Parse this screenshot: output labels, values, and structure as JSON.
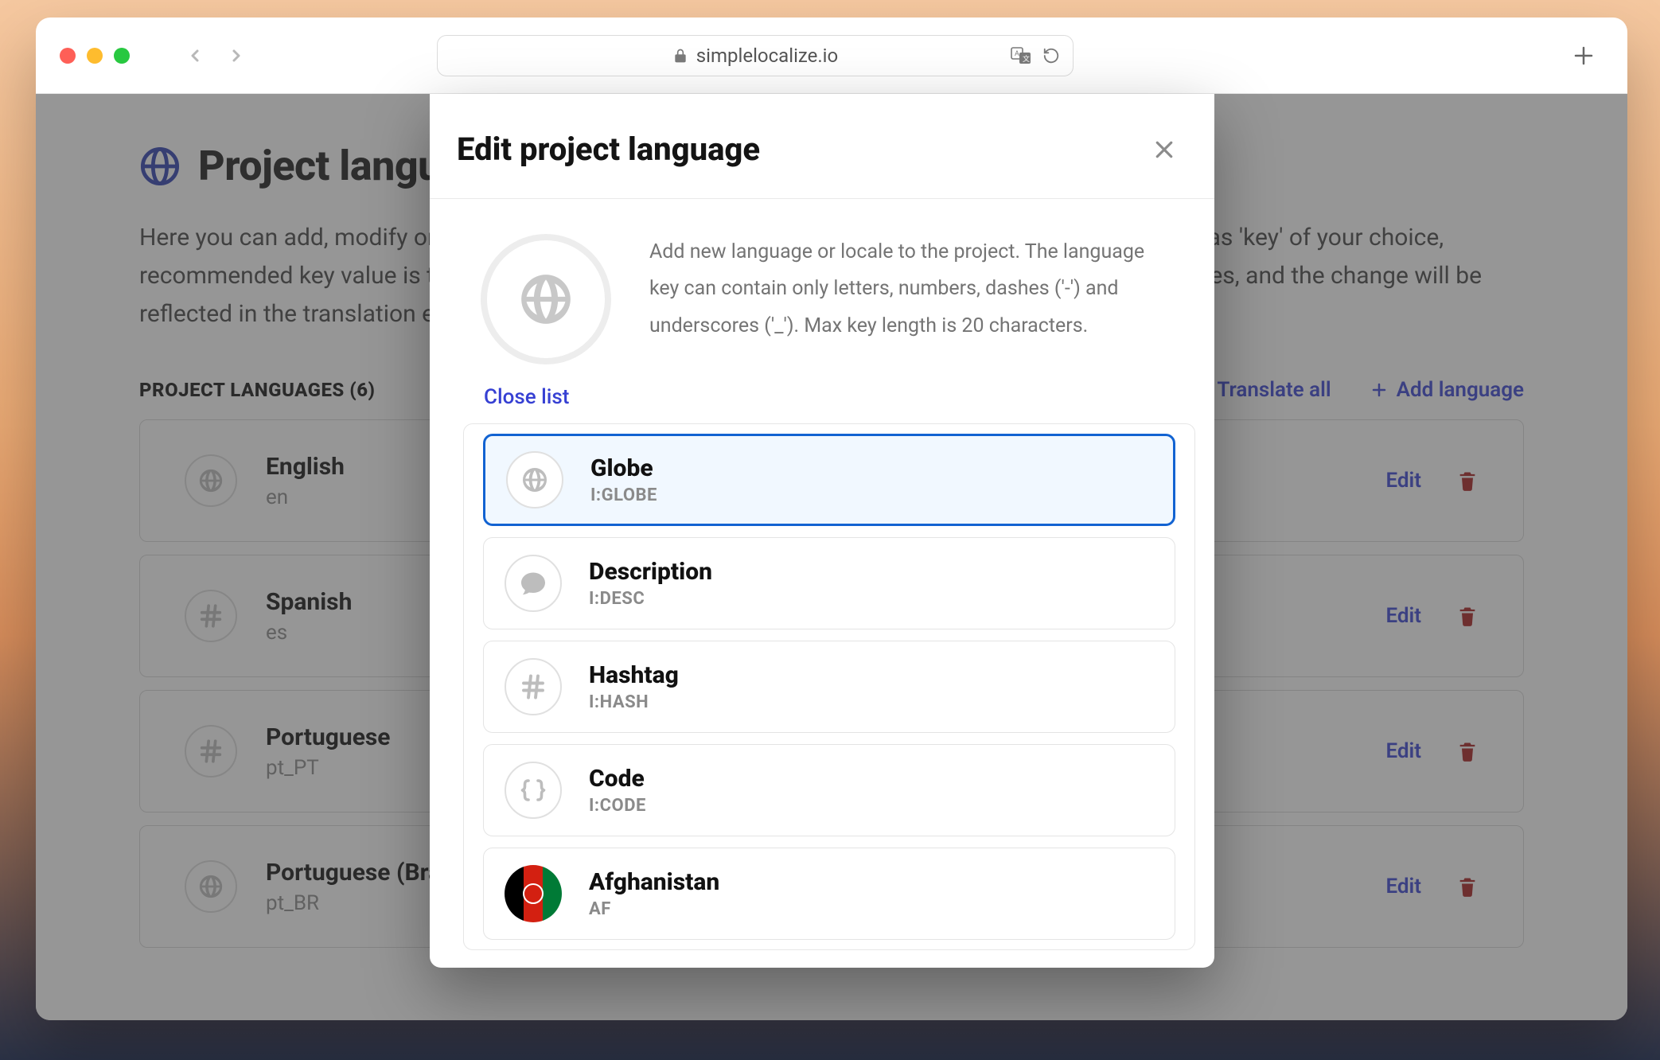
{
  "browser": {
    "url_host": "simplelocalize.io"
  },
  "page": {
    "title": "Project languages",
    "description": "Here you can add, modify or remove project languages along with their translations. Every language has 'key' of your choice, recommended key value is the locale or language code. You can also change the order of the languages, and the change will be reflected in the translation editor.",
    "list_heading": "PROJECT LANGUAGES (6)",
    "actions": {
      "translate_all": "Translate all",
      "add_language": "Add language"
    }
  },
  "languages": [
    {
      "name": "English",
      "key": "en",
      "icon": "globe"
    },
    {
      "name": "Spanish",
      "key": "es",
      "icon": "hash"
    },
    {
      "name": "Portuguese",
      "key": "pt_PT",
      "icon": "hash"
    },
    {
      "name": "Portuguese (Brazil)",
      "key": "pt_BR",
      "icon": "globe"
    }
  ],
  "row_actions": {
    "edit": "Edit"
  },
  "modal": {
    "title": "Edit project language",
    "intro": "Add new language or locale to the project. The language key can contain only letters, numbers, dashes ('-') and underscores ('_'). Max key length is 20 characters.",
    "close_list": "Close list"
  },
  "options": [
    {
      "name": "Globe",
      "key": "I:GLOBE",
      "icon": "globe",
      "selected": true
    },
    {
      "name": "Description",
      "key": "I:DESC",
      "icon": "comment",
      "selected": false
    },
    {
      "name": "Hashtag",
      "key": "I:HASH",
      "icon": "hash",
      "selected": false
    },
    {
      "name": "Code",
      "key": "I:CODE",
      "icon": "code",
      "selected": false
    },
    {
      "name": "Afghanistan",
      "key": "AF",
      "icon": "flag-af",
      "selected": false
    }
  ]
}
